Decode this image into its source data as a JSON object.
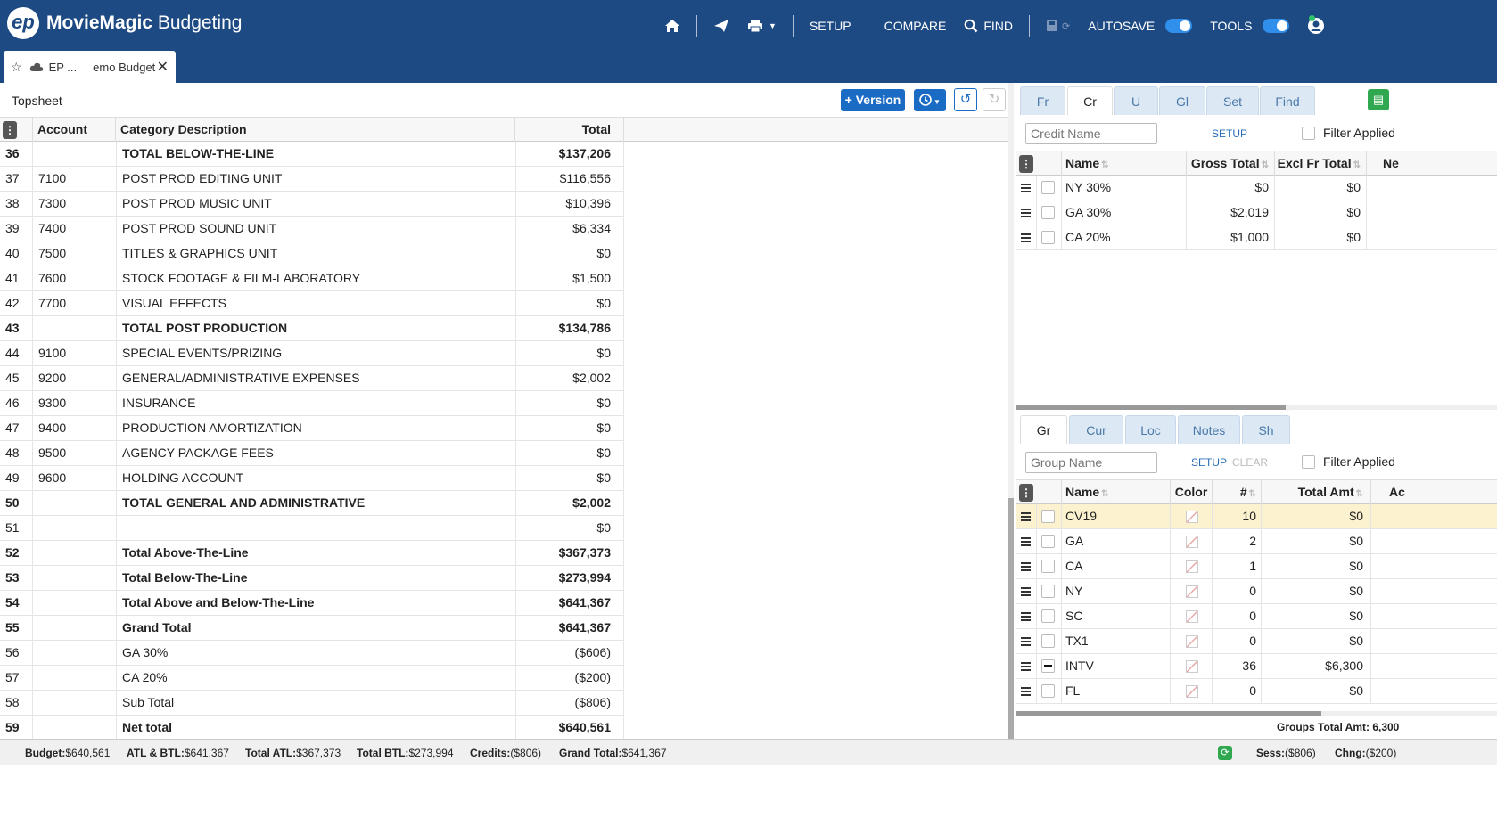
{
  "app": {
    "brand_bold": "MovieMagic",
    "brand_light": " Budgeting",
    "logo_text": "ep"
  },
  "nav": {
    "setup": "SETUP",
    "compare": "COMPARE",
    "find": "FIND",
    "autosave": "AUTOSAVE",
    "tools": "TOOLS"
  },
  "doc_tab": {
    "title": "EP ...     emo Budget",
    "close": "✕"
  },
  "sheet": {
    "label": "Topsheet",
    "version_button": "+ Version"
  },
  "grid": {
    "headers": {
      "account": "Account",
      "description": "Category Description",
      "total": "Total"
    },
    "rows": [
      {
        "num": "36",
        "account": "",
        "desc": "TOTAL BELOW-THE-LINE",
        "total": "$137,206",
        "bold": true
      },
      {
        "num": "37",
        "account": "7100",
        "desc": "POST PROD EDITING UNIT",
        "total": "$116,556",
        "bold": false
      },
      {
        "num": "38",
        "account": "7300",
        "desc": "POST PROD MUSIC UNIT",
        "total": "$10,396",
        "bold": false
      },
      {
        "num": "39",
        "account": "7400",
        "desc": "POST PROD SOUND UNIT",
        "total": "$6,334",
        "bold": false
      },
      {
        "num": "40",
        "account": "7500",
        "desc": "TITLES & GRAPHICS UNIT",
        "total": "$0",
        "bold": false
      },
      {
        "num": "41",
        "account": "7600",
        "desc": "STOCK FOOTAGE & FILM-LABORATORY",
        "total": "$1,500",
        "bold": false
      },
      {
        "num": "42",
        "account": "7700",
        "desc": "VISUAL EFFECTS",
        "total": "$0",
        "bold": false
      },
      {
        "num": "43",
        "account": "",
        "desc": "TOTAL POST PRODUCTION",
        "total": "$134,786",
        "bold": true
      },
      {
        "num": "44",
        "account": "9100",
        "desc": "SPECIAL EVENTS/PRIZING",
        "total": "$0",
        "bold": false
      },
      {
        "num": "45",
        "account": "9200",
        "desc": "GENERAL/ADMINISTRATIVE EXPENSES",
        "total": "$2,002",
        "bold": false
      },
      {
        "num": "46",
        "account": "9300",
        "desc": "INSURANCE",
        "total": "$0",
        "bold": false
      },
      {
        "num": "47",
        "account": "9400",
        "desc": "PRODUCTION AMORTIZATION",
        "total": "$0",
        "bold": false
      },
      {
        "num": "48",
        "account": "9500",
        "desc": "AGENCY PACKAGE FEES",
        "total": "$0",
        "bold": false
      },
      {
        "num": "49",
        "account": "9600",
        "desc": "HOLDING ACCOUNT",
        "total": "$0",
        "bold": false
      },
      {
        "num": "50",
        "account": "",
        "desc": "TOTAL GENERAL AND ADMINISTRATIVE",
        "total": "$2,002",
        "bold": true
      },
      {
        "num": "51",
        "account": "",
        "desc": "",
        "total": "$0",
        "bold": false
      },
      {
        "num": "52",
        "account": "",
        "desc": "Total Above-The-Line",
        "total": "$367,373",
        "bold": true
      },
      {
        "num": "53",
        "account": "",
        "desc": "Total Below-The-Line",
        "total": "$273,994",
        "bold": true
      },
      {
        "num": "54",
        "account": "",
        "desc": "Total Above and Below-The-Line",
        "total": "$641,367",
        "bold": true
      },
      {
        "num": "55",
        "account": "",
        "desc": "Grand Total",
        "total": "$641,367",
        "bold": true
      },
      {
        "num": "56",
        "account": "",
        "desc": "GA 30%",
        "total": "($606)",
        "bold": false
      },
      {
        "num": "57",
        "account": "",
        "desc": "CA 20%",
        "total": "($200)",
        "bold": false
      },
      {
        "num": "58",
        "account": "",
        "desc": "Sub Total",
        "total": "($806)",
        "bold": false
      },
      {
        "num": "59",
        "account": "",
        "desc": "Net total",
        "total": "$640,561",
        "bold": true
      }
    ]
  },
  "credits_panel": {
    "tabs": [
      "Fr",
      "Cr",
      "U",
      "Gl",
      "Set",
      "Find"
    ],
    "active_tab": "Cr",
    "filter_placeholder": "Credit Name",
    "setup_link": "SETUP",
    "filter_applied": "Filter Applied",
    "headers": {
      "name": "Name",
      "gross": "Gross Total",
      "excl": "Excl Fr Total",
      "ne": "Ne"
    },
    "rows": [
      {
        "name": "NY 30%",
        "gross": "$0",
        "excl": "$0"
      },
      {
        "name": "GA 30%",
        "gross": "$2,019",
        "excl": "$0"
      },
      {
        "name": "CA 20%",
        "gross": "$1,000",
        "excl": "$0"
      }
    ]
  },
  "groups_panel": {
    "tabs": [
      "Gr",
      "Cur",
      "Loc",
      "Notes",
      "Sh"
    ],
    "active_tab": "Gr",
    "filter_placeholder": "Group Name",
    "setup_link": "SETUP",
    "clear_link": "CLEAR",
    "filter_applied": "Filter Applied",
    "headers": {
      "name": "Name",
      "color": "Color",
      "count": "#",
      "total": "Total Amt",
      "ac": "Ac"
    },
    "rows": [
      {
        "name": "CV19",
        "count": "10",
        "total": "$0",
        "highlight": true,
        "partial": false
      },
      {
        "name": "GA",
        "count": "2",
        "total": "$0",
        "highlight": false,
        "partial": false
      },
      {
        "name": "CA",
        "count": "1",
        "total": "$0",
        "highlight": false,
        "partial": false
      },
      {
        "name": "NY",
        "count": "0",
        "total": "$0",
        "highlight": false,
        "partial": false
      },
      {
        "name": "SC",
        "count": "0",
        "total": "$0",
        "highlight": false,
        "partial": false
      },
      {
        "name": "TX1",
        "count": "0",
        "total": "$0",
        "highlight": false,
        "partial": false
      },
      {
        "name": "INTV",
        "count": "36",
        "total": "$6,300",
        "highlight": false,
        "partial": true
      },
      {
        "name": "FL",
        "count": "0",
        "total": "$0",
        "highlight": false,
        "partial": false
      }
    ],
    "groups_total": "Groups Total Amt: 6,300"
  },
  "status": {
    "budget_label": "Budget:",
    "budget": "$640,561",
    "atlbtl_label": "ATL & BTL:",
    "atlbtl": "$641,367",
    "atl_label": "Total ATL:",
    "atl": "$367,373",
    "btl_label": "Total BTL:",
    "btl": "$273,994",
    "credits_label": "Credits:",
    "credits": "($806)",
    "grand_label": "Grand Total:",
    "grand": "$641,367",
    "sess_label": "Sess:",
    "sess": "($806)",
    "chng_label": "Chng:",
    "chng": "($200)"
  },
  "colors": {
    "topbar": "#1e4a84",
    "accent": "#1a6bc4",
    "highlight_row": "#fcf2cf",
    "green": "#2fa84f"
  }
}
